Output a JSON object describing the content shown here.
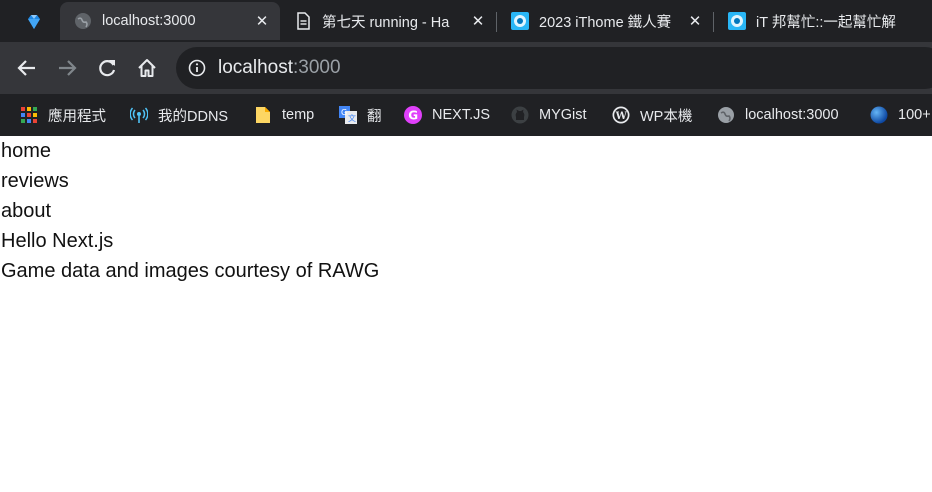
{
  "browser": {
    "tabs": [
      {
        "title": "localhost:3000",
        "active": true,
        "favicon": "globe-icon"
      },
      {
        "title": "第七天 running - Ha",
        "active": false,
        "favicon": "document-icon"
      },
      {
        "title": "2023 iThome 鐵人賽",
        "active": false,
        "favicon": "ithome-icon"
      },
      {
        "title": "iT 邦幫忙::一起幫忙解",
        "active": false,
        "favicon": "ithome-icon"
      }
    ],
    "close_glyph": "✕",
    "address": {
      "host": "localhost",
      "port": ":3000"
    },
    "bookmarks": [
      {
        "label": "應用程式",
        "icon": "apps-grid-icon"
      },
      {
        "label": "我的DDNS",
        "icon": "antenna-icon"
      },
      {
        "label": "temp",
        "icon": "folder-icon"
      },
      {
        "label": "翻",
        "icon": "translate-icon"
      },
      {
        "label": "NEXT.JS",
        "icon": "g-icon"
      },
      {
        "label": "MYGist",
        "icon": "github-icon"
      },
      {
        "label": "WP本機",
        "icon": "wordpress-icon"
      },
      {
        "label": "localhost:3000",
        "icon": "globe-icon"
      },
      {
        "label": "100+",
        "icon": "orb-icon"
      }
    ]
  },
  "page": {
    "nav": [
      "home",
      "reviews",
      "about"
    ],
    "heading": "Hello Next.js",
    "footer": "Game data and images courtesy of RAWG"
  }
}
